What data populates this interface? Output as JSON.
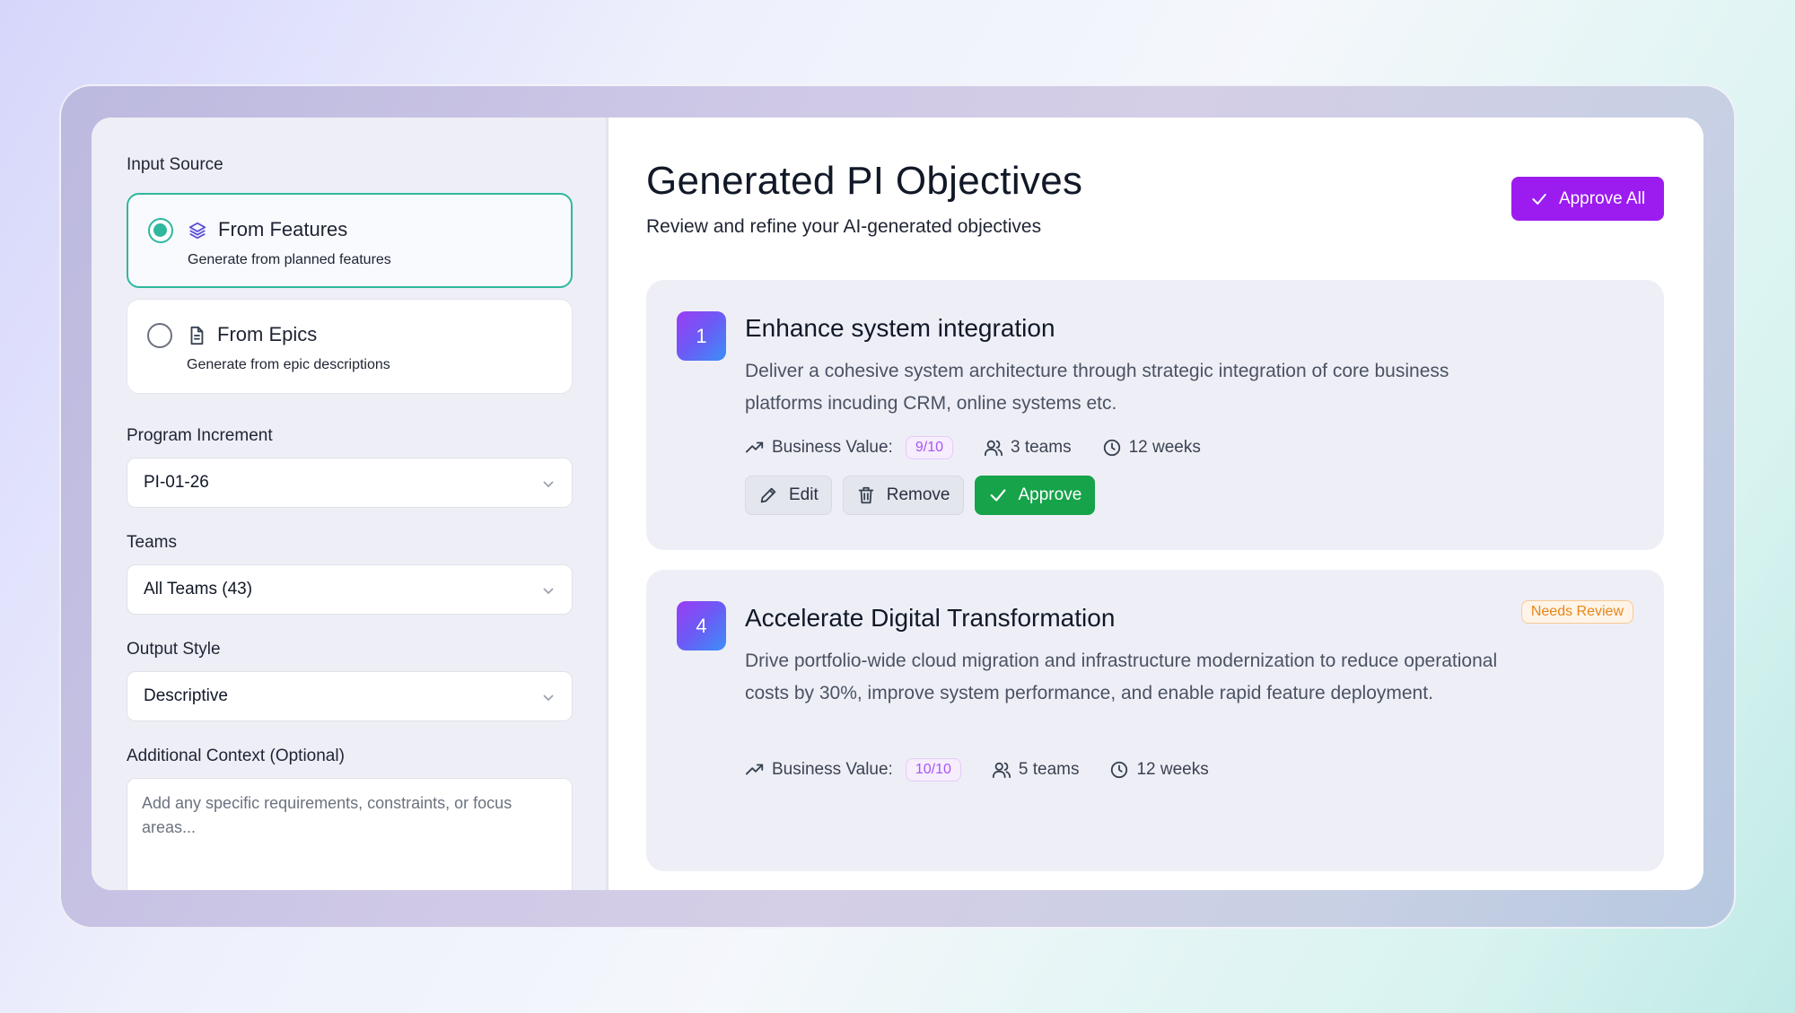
{
  "left_panel": {
    "input_source_label": "Input Source",
    "sources": [
      {
        "title": "From Features",
        "description": "Generate from planned features",
        "selected": true,
        "icon": "layers-icon"
      },
      {
        "title": "From Epics",
        "description": "Generate from epic descriptions",
        "selected": false,
        "icon": "document-icon"
      }
    ],
    "program_increment": {
      "label": "Program Increment",
      "value": "PI-01-26"
    },
    "teams": {
      "label": "Teams",
      "value": "All Teams (43)"
    },
    "output_style": {
      "label": "Output Style",
      "value": "Descriptive"
    },
    "additional_context": {
      "label": "Additional Context (Optional)",
      "placeholder": "Add any specific requirements, constraints, or focus areas..."
    }
  },
  "main": {
    "title": "Generated PI Objectives",
    "subtitle": "Review and refine your AI-generated objectives",
    "approve_all_label": "Approve All",
    "objectives": [
      {
        "number": "1",
        "title": "Enhance system integration",
        "description": "Deliver a cohesive system architecture through strategic integration of core business platforms incuding CRM, online systems etc.",
        "business_value_label": "Business Value:",
        "business_value": "9/10",
        "teams": "3 teams",
        "duration": "12 weeks",
        "actions": {
          "edit": "Edit",
          "remove": "Remove",
          "approve": "Approve"
        }
      },
      {
        "number": "4",
        "title": "Accelerate Digital Transformation",
        "description": "Drive portfolio-wide cloud migration and infrastructure modernization to reduce operational costs by 30%, improve system performance, and enable rapid feature deployment.",
        "business_value_label": "Business Value:",
        "business_value": "10/10",
        "teams": "5 teams",
        "duration": "12 weeks",
        "status": "Needs Review"
      }
    ]
  },
  "colors": {
    "accent_purple": "#9c1cf0",
    "selected_teal": "#2fb89e",
    "approve_green": "#16a34a",
    "needs_review_orange": "#e88616"
  }
}
